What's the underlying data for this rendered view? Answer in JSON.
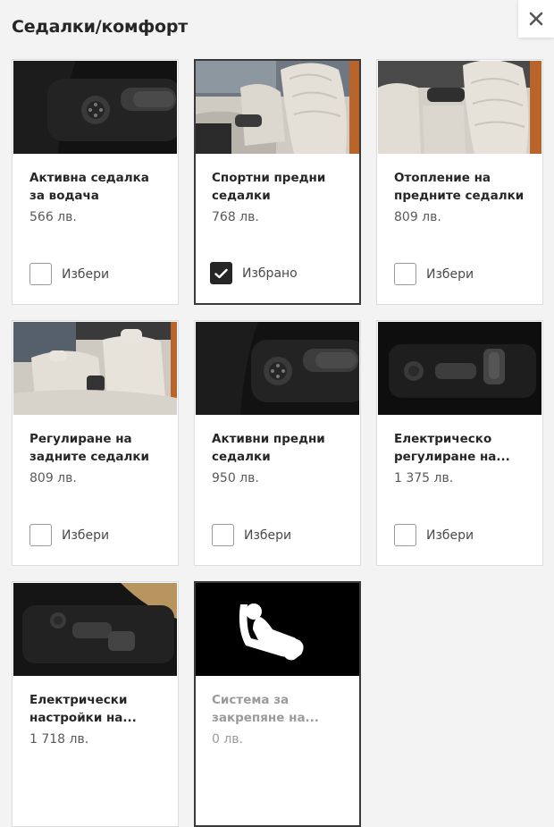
{
  "page": {
    "title": "Седалки/комфорт"
  },
  "icons": {
    "close": "close-icon",
    "check": "checkmark-icon",
    "seat": "child-seat-anchor-icon"
  },
  "colors": {
    "text": "#262626",
    "price": "#5a5a5a",
    "disabled": "#9b9b9b",
    "border_selected": "#3a3a3a"
  },
  "cards": [
    {
      "name": "Активна седалка за водача",
      "price": "566 лв.",
      "check_label": "Избери",
      "selected": false
    },
    {
      "name": "Спортни предни седалки",
      "price": "768 лв.",
      "check_label": "Избрано",
      "selected": true
    },
    {
      "name": "Отопление на предните седалки",
      "price": "809 лв.",
      "check_label": "Избери",
      "selected": false
    },
    {
      "name": "Регулиране на задните седалки",
      "price": "809 лв.",
      "check_label": "Избери",
      "selected": false
    },
    {
      "name": "Активни предни седалки",
      "price": "950 лв.",
      "check_label": "Избери",
      "selected": false
    },
    {
      "name": "Електрическо регулиране на...",
      "price": "1 375 лв.",
      "check_label": "Избери",
      "selected": false
    },
    {
      "name": "Електрически настройки на...",
      "price": "1 718 лв.",
      "check_label": "",
      "selected": false
    },
    {
      "name": "Система за закрепяне на...",
      "price": "0 лв.",
      "check_label": "",
      "selected": false,
      "disabled": true
    }
  ]
}
